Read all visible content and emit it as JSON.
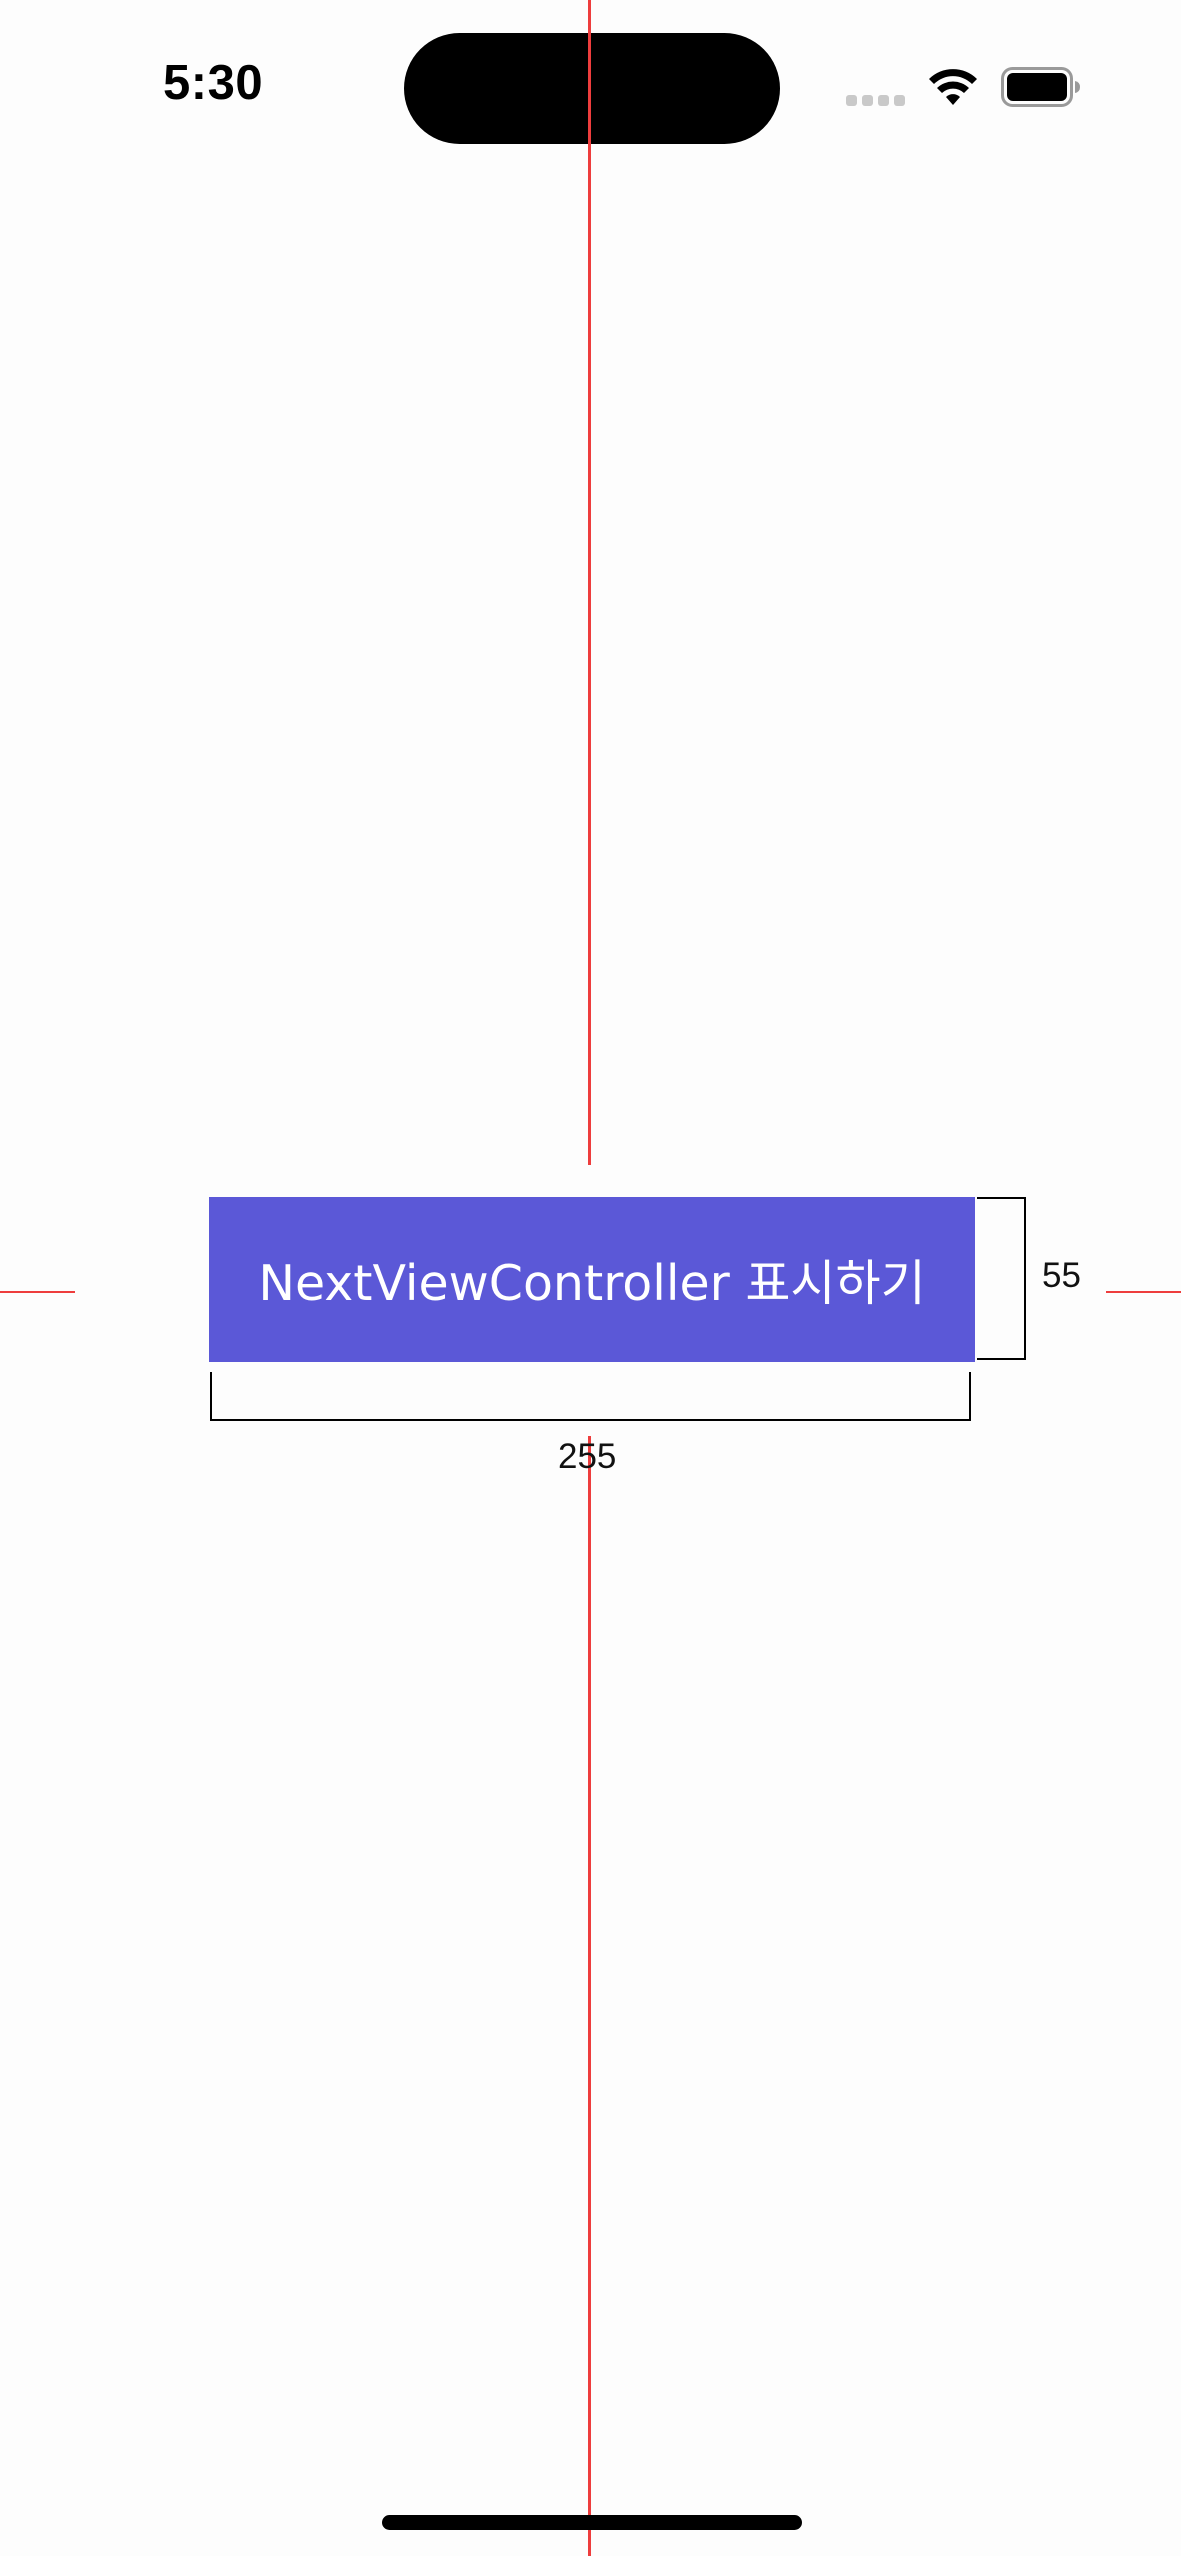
{
  "status_bar": {
    "time": "5:30"
  },
  "main": {
    "button_label": "NextViewController 표시하기",
    "button_color": "#5b58d7",
    "guide_color": "#ee3d3d"
  },
  "annotations": {
    "height_label": "55",
    "width_label": "255"
  }
}
